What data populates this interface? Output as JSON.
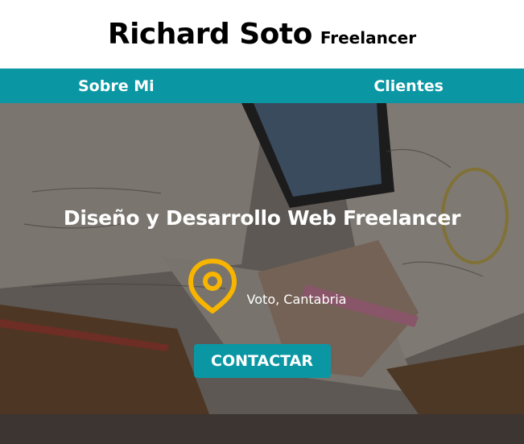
{
  "header": {
    "name": "Richard Soto",
    "role": "Freelancer"
  },
  "nav": {
    "items": [
      {
        "label": "Sobre Mi"
      },
      {
        "label": "Clientes"
      }
    ]
  },
  "hero": {
    "title": "Diseño y Desarrollo Web Freelancer",
    "location": "Voto, Cantabria",
    "location_icon": "map-pin-icon",
    "cta_label": "CONTACTAR"
  },
  "colors": {
    "accent": "#0a97a3",
    "pin": "#f7b500",
    "header_bg": "#ffffff"
  }
}
